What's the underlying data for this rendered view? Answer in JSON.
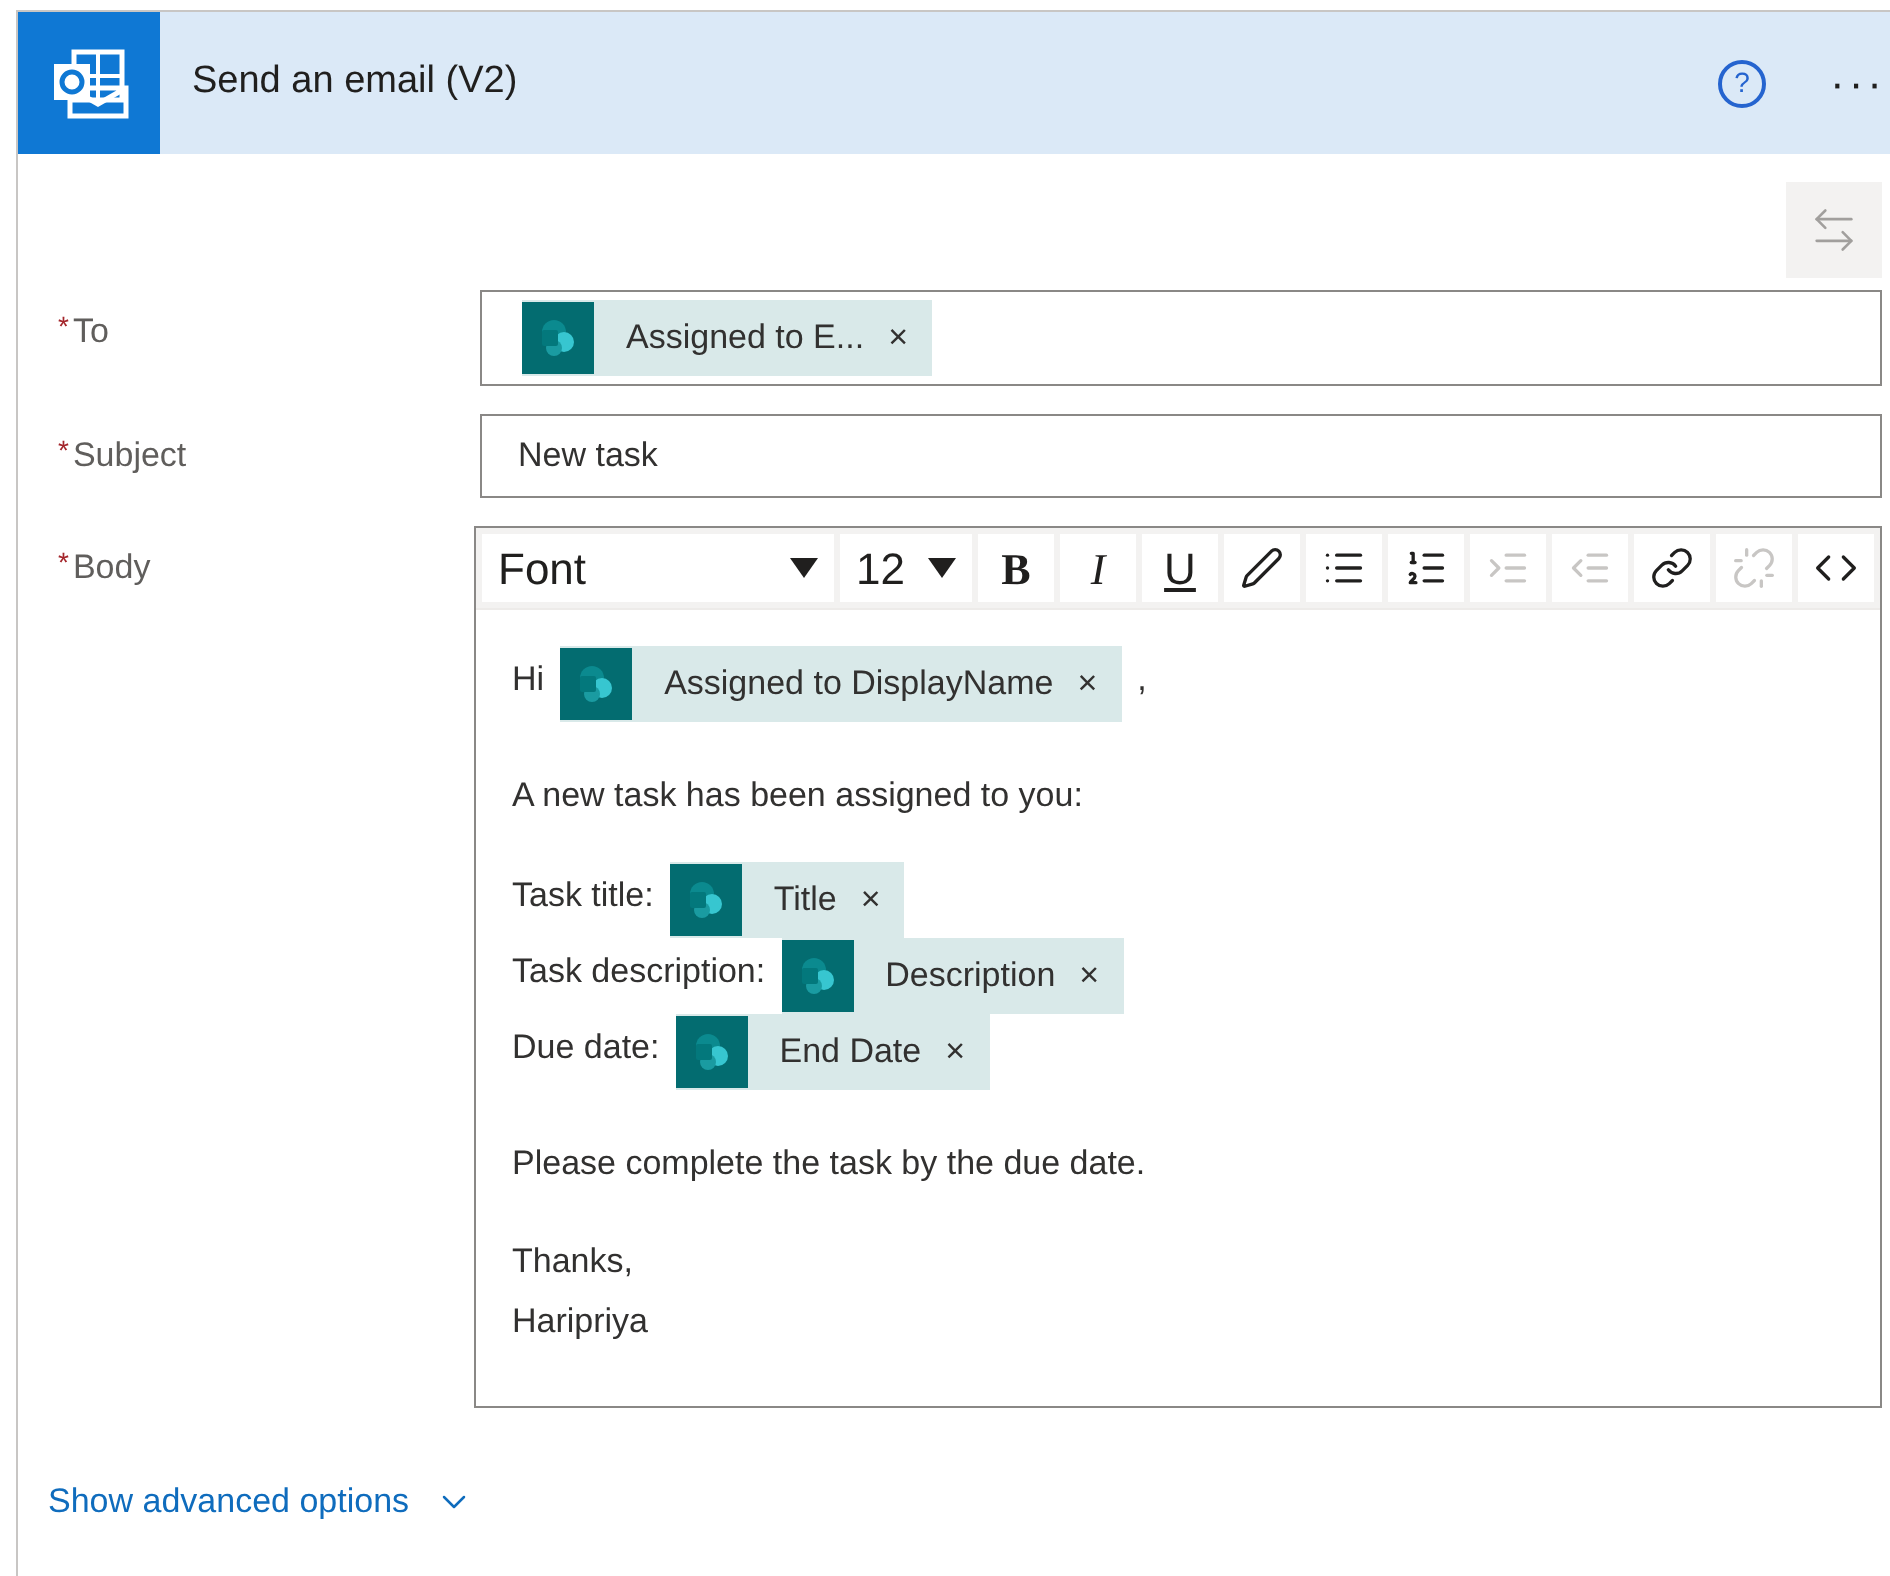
{
  "header": {
    "title": "Send an email (V2)",
    "help": "?",
    "more": "···"
  },
  "fields": [
    {
      "label": "To",
      "required_mark": "*",
      "kind": "tokens",
      "tokens": [
        {
          "label": "Assigned to E...",
          "remove": "×"
        }
      ]
    },
    {
      "label": "Subject",
      "required_mark": "*",
      "kind": "text",
      "value": "New task"
    },
    {
      "label": "Body",
      "required_mark": "*",
      "kind": "editor"
    }
  ],
  "toolbar": {
    "font": "Font",
    "size": "12",
    "buttons": [
      {
        "kind": "bold",
        "text": "B",
        "disabled": false
      },
      {
        "kind": "italic",
        "text": "I",
        "disabled": false
      },
      {
        "kind": "underline",
        "text": "U",
        "disabled": false
      },
      {
        "kind": "pen",
        "disabled": false
      },
      {
        "kind": "bullets",
        "disabled": false
      },
      {
        "kind": "numbers",
        "disabled": false
      },
      {
        "kind": "indent",
        "disabled": true
      },
      {
        "kind": "outdent",
        "disabled": true
      },
      {
        "kind": "link",
        "disabled": false
      },
      {
        "kind": "unlink",
        "disabled": true
      },
      {
        "kind": "code",
        "disabled": false
      }
    ]
  },
  "body": {
    "paragraphs": [
      [
        [
          {
            "kind": "text",
            "text": "Hi"
          },
          {
            "kind": "token",
            "label": "Assigned to DisplayName",
            "remove": "×"
          },
          {
            "kind": "text",
            "text": ","
          }
        ]
      ],
      [
        [
          {
            "kind": "text",
            "text": "A new task has been assigned to you:"
          }
        ]
      ],
      [
        [
          {
            "kind": "text",
            "text": "Task title:"
          },
          {
            "kind": "token",
            "label": "Title",
            "remove": "×"
          }
        ],
        [
          {
            "kind": "text",
            "text": "Task description:"
          },
          {
            "kind": "token",
            "label": "Description",
            "remove": "×"
          }
        ],
        [
          {
            "kind": "text",
            "text": "Due date:"
          },
          {
            "kind": "token",
            "label": "End Date",
            "remove": "×"
          }
        ]
      ],
      [
        [
          {
            "kind": "text",
            "text": "Please complete the task by the due date."
          }
        ]
      ],
      [
        [
          {
            "kind": "text",
            "text": "Thanks,"
          }
        ],
        [
          {
            "kind": "text",
            "text": "Haripriya"
          }
        ]
      ]
    ]
  },
  "advanced": {
    "label": "Show advanced options"
  }
}
